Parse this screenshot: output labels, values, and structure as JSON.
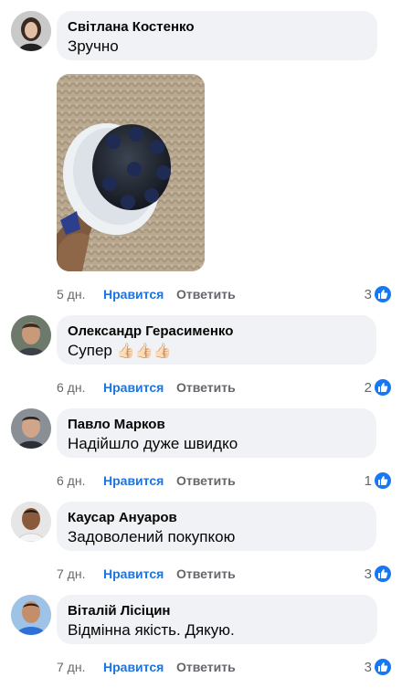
{
  "comments": [
    {
      "author": "Світлана Костенко",
      "text": "Зручно",
      "has_photo": true,
      "time": "5 дн.",
      "like_label": "Нравится",
      "reply_label": "Ответить",
      "reaction_count": "3",
      "reaction_icon": "thumbs-up-icon"
    },
    {
      "author": "Олександр Герасименко",
      "text": "Супер",
      "emoji": "👍🏻👍🏻👍🏻",
      "time": "6 дн.",
      "like_label": "Нравится",
      "reply_label": "Ответить",
      "reaction_count": "2",
      "reaction_icon": "thumbs-up-icon"
    },
    {
      "author": "Павло Марков",
      "text": "Надійшло дуже швидко",
      "time": "6 дн.",
      "like_label": "Нравится",
      "reply_label": "Ответить",
      "reaction_count": "1",
      "reaction_icon": "thumbs-up-icon"
    },
    {
      "author": "Каусар Ануаров",
      "text": "Задоволений покупкою",
      "time": "7 дн.",
      "like_label": "Нравится",
      "reply_label": "Ответить",
      "reaction_count": "3",
      "reaction_icon": "thumbs-up-icon"
    },
    {
      "author": "Віталій Лісіцин",
      "text": "Відмінна якість. Дякую.",
      "time": "7 дн.",
      "like_label": "Нравится",
      "reply_label": "Ответить",
      "reaction_count": "3",
      "reaction_icon": "thumbs-up-icon"
    }
  ],
  "colors": {
    "bubble_bg": "#f0f2f5",
    "like_blue": "#1b74e4",
    "meta_gray": "#65676b",
    "reaction_blue": "#1877f2"
  }
}
